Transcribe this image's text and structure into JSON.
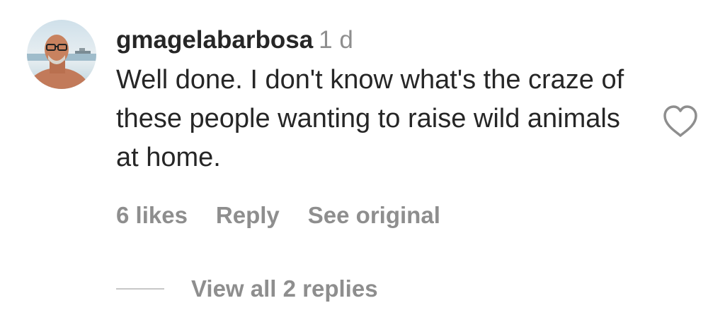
{
  "comment": {
    "username": "gmagelabarbosa",
    "time": "1 d",
    "text": "Well done. I don't know what's the craze of these people wanting to raise wild animals at home.",
    "avatar_icon": "profile-photo",
    "like_icon": "heart-outline-icon"
  },
  "actions": {
    "likes": "6 likes",
    "reply": "Reply",
    "see_original": "See original"
  },
  "replies": {
    "label": "View all 2 replies"
  },
  "colors": {
    "primary_text": "#262626",
    "secondary_text": "#8e8e8e",
    "divider": "#c7c7c7"
  }
}
